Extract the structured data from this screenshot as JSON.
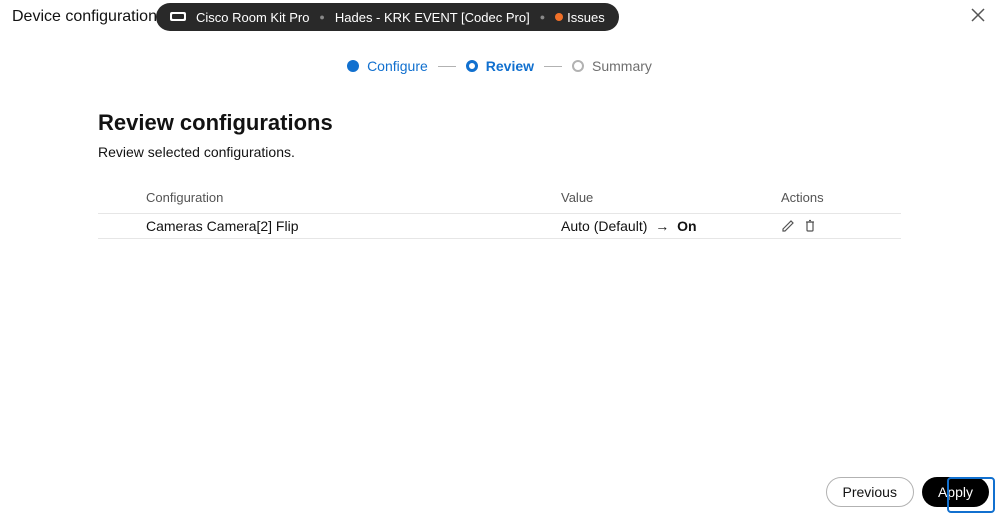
{
  "header": {
    "title": "Device configurations",
    "pill": {
      "device_model": "Cisco Room Kit Pro",
      "device_name": "Hades - KRK EVENT [Codec Pro]",
      "issues_label": "Issues"
    }
  },
  "stepper": {
    "configure": "Configure",
    "review": "Review",
    "summary": "Summary"
  },
  "page": {
    "heading": "Review configurations",
    "sub": "Review selected configurations."
  },
  "table": {
    "columns": {
      "configuration": "Configuration",
      "value": "Value",
      "actions": "Actions"
    },
    "rows": [
      {
        "configuration": "Cameras Camera[2] Flip",
        "old_value": "Auto (Default)",
        "arrow": "→",
        "new_value": "On"
      }
    ]
  },
  "footer": {
    "previous": "Previous",
    "apply": "Apply"
  }
}
